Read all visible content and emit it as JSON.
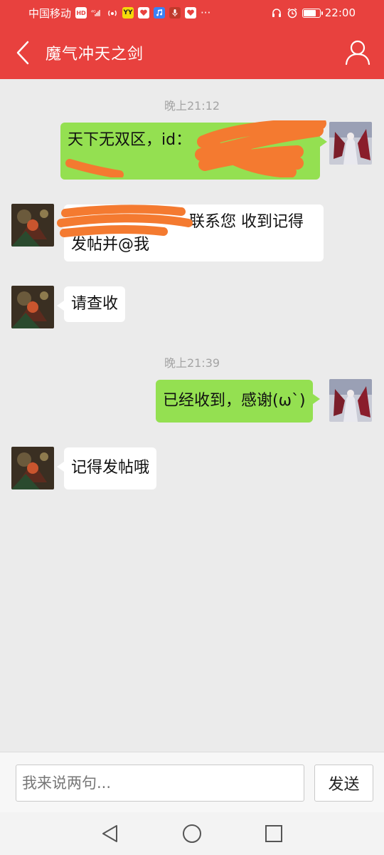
{
  "status_bar": {
    "carrier": "中国移动",
    "time": "22:00",
    "battery_level": 0.8,
    "left_icons": [
      "hd-icon",
      "signal-4g-icon",
      "hotspot-icon",
      "yy-app-icon",
      "heart-app-icon",
      "music-app-icon",
      "microphone-app-icon",
      "heart-app-icon",
      "more-dots-icon"
    ],
    "right_icons": [
      "headset-icon",
      "alarm-icon",
      "battery-icon"
    ],
    "hd_label": "HD",
    "net_label": "4G",
    "yy_label": "YY",
    "more_label": "···"
  },
  "header": {
    "title": "魔气冲天之剑",
    "back_icon": "back-arrow-icon",
    "profile_icon": "user-profile-icon"
  },
  "chat": {
    "timestamps": [
      "晚上21:12",
      "晚上21:39"
    ],
    "messages": [
      {
        "side": "me",
        "line1": "天下无双区，id：",
        "line2": ""
      },
      {
        "side": "other",
        "line1": "联系您 收到记得",
        "line2": "发帖并@我"
      },
      {
        "side": "other",
        "text": "请查收"
      },
      {
        "side": "me",
        "text": "已经收到，感谢(ω`)"
      },
      {
        "side": "other",
        "text": "记得发帖哦"
      }
    ],
    "redaction_color": "#f47a30"
  },
  "input_bar": {
    "placeholder": "我来说两句...",
    "value": "",
    "send_label": "发送"
  },
  "nav_bar": {
    "icons": [
      "nav-back-icon",
      "nav-home-icon",
      "nav-recents-icon"
    ]
  },
  "colors": {
    "header_red": "#e8413e",
    "my_bubble": "#94e051",
    "other_bubble": "#ffffff",
    "background": "#ebebeb"
  }
}
